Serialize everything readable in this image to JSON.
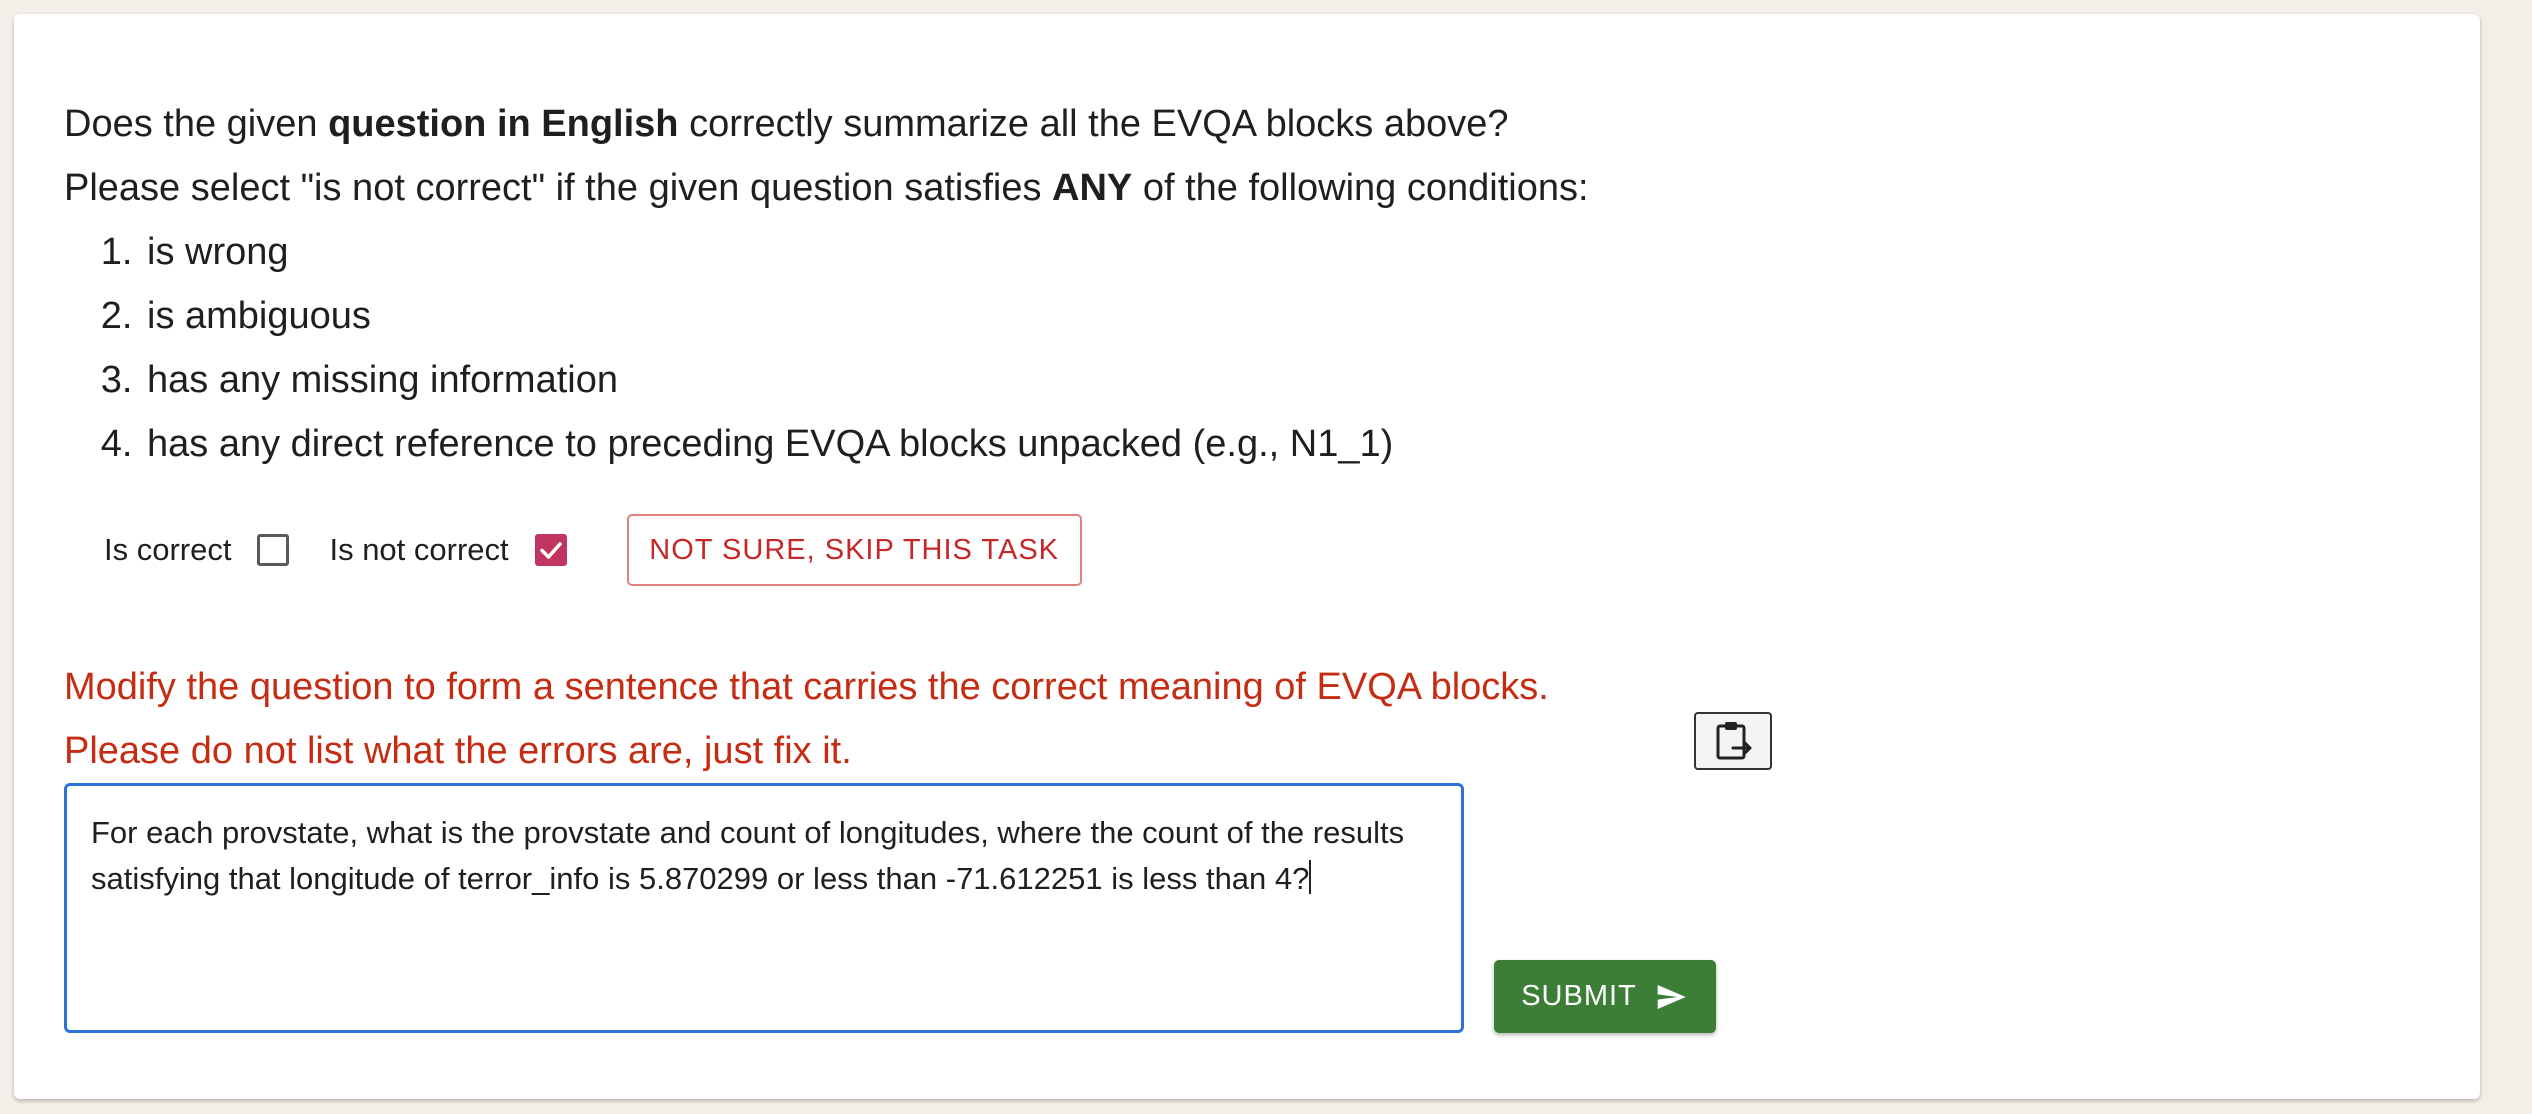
{
  "instructions": {
    "line1_pre": "Does the given ",
    "line1_bold": "question in English",
    "line1_post": " correctly summarize all the EVQA blocks above?",
    "line2_pre": "Please select \"is not correct\" if the given question satisfies ",
    "line2_bold": "ANY",
    "line2_post": " of the following conditions:",
    "conditions": [
      "is wrong",
      "is ambiguous",
      "has any missing information",
      "has any direct reference to preceding EVQA blocks unpacked (e.g., N1_1)"
    ]
  },
  "choices": {
    "correct_label": "Is correct",
    "correct_checked": false,
    "not_correct_label": "Is not correct",
    "not_correct_checked": true,
    "skip_label": "NOT SURE, SKIP THIS TASK"
  },
  "modify": {
    "line1": "Modify the question to form a sentence that carries the correct meaning of EVQA blocks.",
    "line2": "Please do not list what the errors are, just fix it."
  },
  "answer": {
    "text": "For each provstate, what is the provstate and count of longitudes, where the count of the results satisfying that longitude of terror_info is 5.870299 or less than -71.612251  is less than 4?"
  },
  "submit": {
    "label": "SUBMIT"
  },
  "colors": {
    "accent_red": "#c62c12",
    "check_pink": "#c23561",
    "submit_green": "#3d7e37",
    "focus_blue": "#2a72d6"
  },
  "icons": {
    "clipboard": "clipboard-paste-icon",
    "send": "send-icon",
    "check": "check-icon"
  }
}
